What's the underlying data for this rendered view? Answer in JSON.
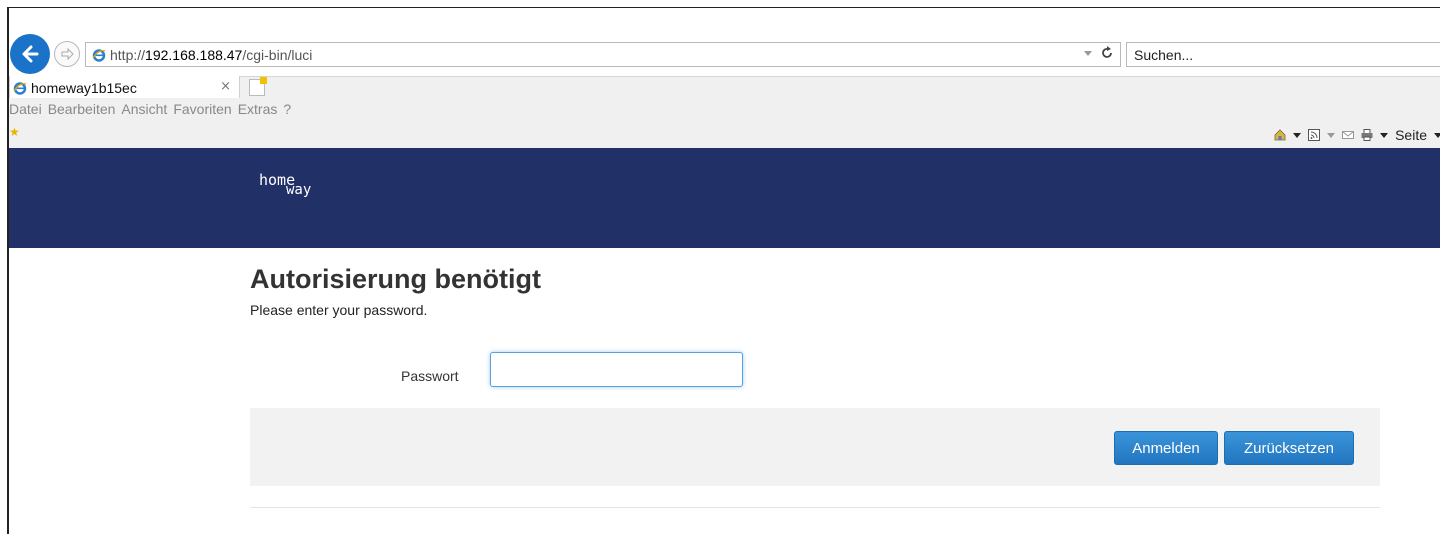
{
  "browser": {
    "url_prefix": "http://",
    "url_host": "192.168.188.47",
    "url_path": "/cgi-bin/luci",
    "search_placeholder": "Suchen...",
    "tab_title": "homeway1b15ec",
    "tab_close": "×",
    "menu": [
      "Datei",
      "Bearbeiten",
      "Ansicht",
      "Favoriten",
      "Extras",
      "?"
    ],
    "cmd_page_label": "Seite",
    "icons": [
      "back-arrow-icon",
      "forward-arrow-icon",
      "ie-icon",
      "refresh-icon",
      "home-icon",
      "feeds-icon",
      "mail-icon",
      "print-icon",
      "favorites-star-icon"
    ]
  },
  "page": {
    "logo_line1": "home",
    "logo_line2": "way",
    "title": "Autorisierung benötigt",
    "subtitle": "Please enter your password.",
    "password_label": "Passwort",
    "password_value": "",
    "login_button": "Anmelden",
    "reset_button": "Zurücksetzen"
  },
  "colors": {
    "header": "#213066",
    "button": "#2a80c9",
    "back_button": "#1a73c8"
  }
}
